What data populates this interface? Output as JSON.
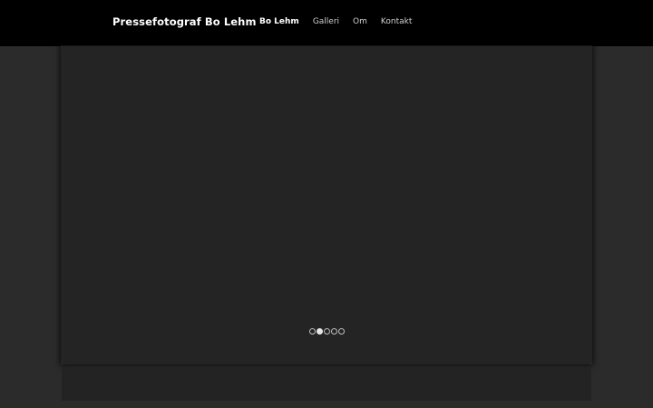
{
  "header": {
    "site_title": "Pressefotograf Bo Lehm",
    "nav": [
      {
        "label": "Bo Lehm",
        "active": true
      },
      {
        "label": "Galleri",
        "active": false
      },
      {
        "label": "Om",
        "active": false
      },
      {
        "label": "Kontakt",
        "active": false
      }
    ]
  },
  "slider": {
    "slide_count": 5,
    "active_index": 1
  },
  "colors": {
    "header_bg": "#000000",
    "page_bg": "#2b2b2b",
    "slider_bg": "#242424"
  }
}
